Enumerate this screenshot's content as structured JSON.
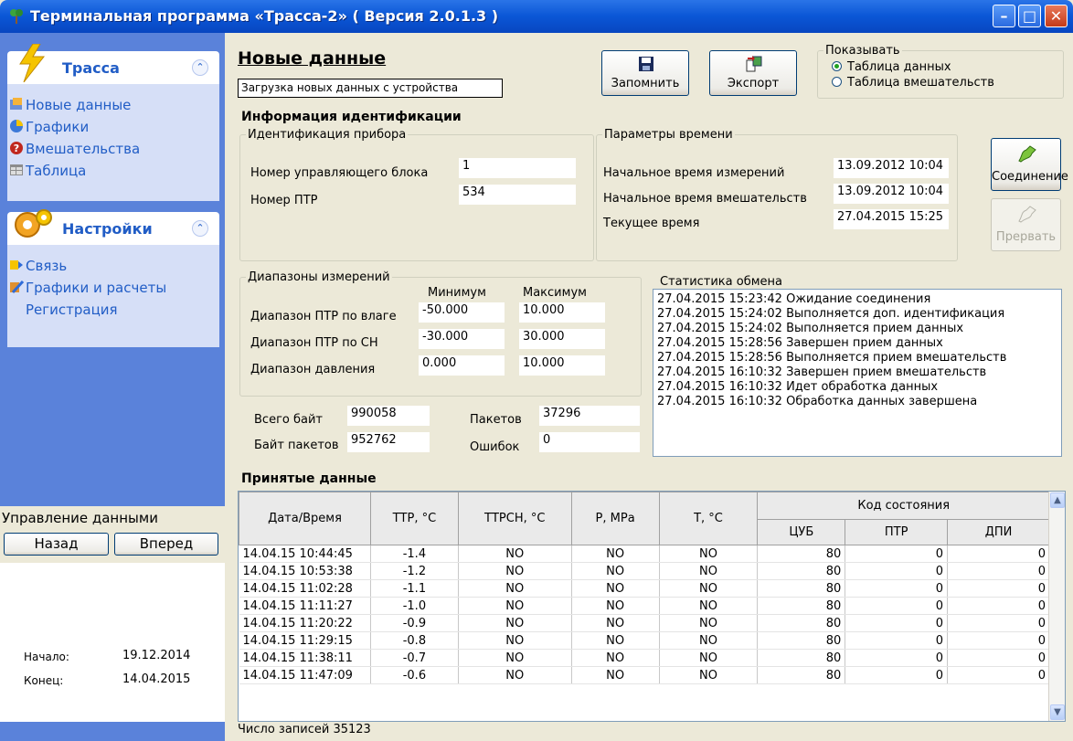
{
  "window": {
    "title": "Терминальная программа «Трасса-2» ( Версия 2.0.1.3 )",
    "accent": "#0A56D6"
  },
  "sidebar": {
    "section1": {
      "title": "Трасса",
      "items": [
        {
          "label": "Новые данные",
          "icon": "new-data-icon"
        },
        {
          "label": "Графики",
          "icon": "chart-icon"
        },
        {
          "label": "Вмешательства",
          "icon": "question-icon"
        },
        {
          "label": "Таблица",
          "icon": "table-icon"
        }
      ]
    },
    "section2": {
      "title": "Настройки",
      "items": [
        {
          "label": "Связь",
          "icon": "link-icon"
        },
        {
          "label": "Графики и расчеты",
          "icon": "calc-icon"
        },
        {
          "label": "Регистрация",
          "icon": ""
        }
      ]
    },
    "data_control": {
      "header": "Управление данными",
      "back_label": "Назад",
      "forward_label": "Вперед",
      "start_label": "Начало:",
      "start_value": "19.12.2014",
      "end_label": "Конец:",
      "end_value": "14.04.2015"
    }
  },
  "main": {
    "title": "Новые данные",
    "subtitle": "Загрузка новых данных с устройства",
    "save_label": "Запомнить",
    "export_label": "Экспорт",
    "show": {
      "legend": "Показывать",
      "options": [
        "Таблица данных",
        "Таблица вмешательств"
      ],
      "selected": 0
    },
    "id_info": {
      "title": "Информация идентификации",
      "device": {
        "legend": "Идентификация прибора",
        "control_unit_label": "Номер управляющего блока",
        "control_unit_value": "1",
        "ptr_label": "Номер ПТР",
        "ptr_value": "534"
      },
      "time": {
        "legend": "Параметры времени",
        "meas_start_label": "Начальное время измерений",
        "meas_start_value": "13.09.2012 10:04",
        "interv_start_label": "Начальное время вмешательств",
        "interv_start_value": "13.09.2012 10:04",
        "current_label": "Текущее время",
        "current_value": "27.04.2015 15:25"
      },
      "connect_label": "Соединение",
      "abort_label": "Прервать",
      "ranges": {
        "legend": "Диапазоны измерений",
        "min_header": "Минимум",
        "max_header": "Максимум",
        "rows": [
          {
            "label": "Диапазон ПТР по влаге",
            "min": "-50.000",
            "max": "10.000"
          },
          {
            "label": "Диапазон ПТР по СН",
            "min": "-30.000",
            "max": "30.000"
          },
          {
            "label": "Диапазон давления",
            "min": "0.000",
            "max": "10.000"
          }
        ]
      },
      "totals": {
        "bytes_label": "Всего байт",
        "bytes_value": "990058",
        "packets_label": "Пакетов",
        "packets_value": "37296",
        "packet_bytes_label": "Байт пакетов",
        "packet_bytes_value": "952762",
        "errors_label": "Ошибок",
        "errors_value": "0"
      },
      "stats": {
        "legend": "Статистика обмена",
        "lines": [
          "27.04.2015 15:23:42 Ожидание соединения",
          "27.04.2015 15:24:02 Выполняется доп. идентификация",
          "27.04.2015 15:24:02 Выполняется прием данных",
          "27.04.2015 15:28:56 Завершен прием данных",
          "27.04.2015 15:28:56 Выполняется прием вмешательств",
          "27.04.2015 16:10:32 Завершен прием вмешательств",
          "27.04.2015 16:10:32 Идет обработка данных",
          "27.04.2015 16:10:32 Обработка данных завершена"
        ]
      }
    },
    "received": {
      "title": "Принятые данные",
      "columns": [
        "Дата/Время",
        "ТТР, °С",
        "ТТРСН, °С",
        "Р, МРа",
        "Т, °С"
      ],
      "state_header": "Код состояния",
      "state_columns": [
        "ЦУБ",
        "ПТР",
        "ДПИ"
      ],
      "rows": [
        [
          "14.04.15 10:44:45",
          "-1.4",
          "NO",
          "NO",
          "NO",
          "80",
          "0",
          "0"
        ],
        [
          "14.04.15 10:53:38",
          "-1.2",
          "NO",
          "NO",
          "NO",
          "80",
          "0",
          "0"
        ],
        [
          "14.04.15 11:02:28",
          "-1.1",
          "NO",
          "NO",
          "NO",
          "80",
          "0",
          "0"
        ],
        [
          "14.04.15 11:11:27",
          "-1.0",
          "NO",
          "NO",
          "NO",
          "80",
          "0",
          "0"
        ],
        [
          "14.04.15 11:20:22",
          "-0.9",
          "NO",
          "NO",
          "NO",
          "80",
          "0",
          "0"
        ],
        [
          "14.04.15 11:29:15",
          "-0.8",
          "NO",
          "NO",
          "NO",
          "80",
          "0",
          "0"
        ],
        [
          "14.04.15 11:38:11",
          "-0.7",
          "NO",
          "NO",
          "NO",
          "80",
          "0",
          "0"
        ],
        [
          "14.04.15 11:47:09",
          "-0.6",
          "NO",
          "NO",
          "NO",
          "80",
          "0",
          "0"
        ]
      ],
      "record_count": "Число записей 35123"
    }
  }
}
